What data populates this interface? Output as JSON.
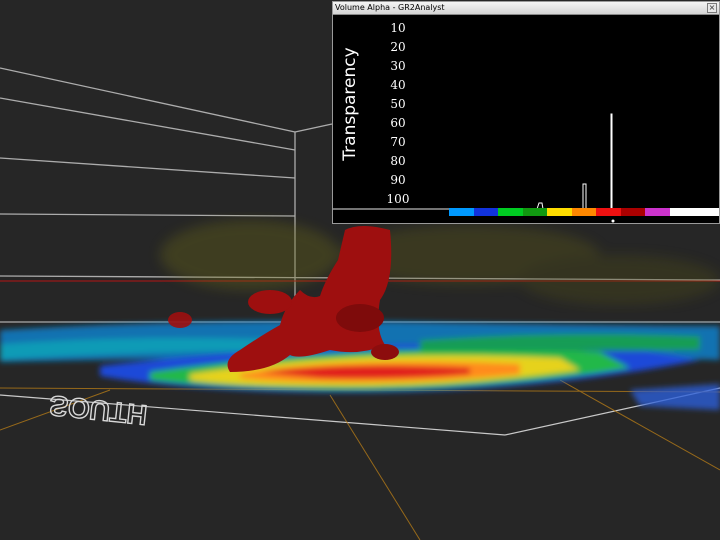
{
  "window": {
    "title": "Volume Alpha - GR2Analyst",
    "close_label": "×"
  },
  "chart_data": {
    "type": "line",
    "ylabel": "Transparency",
    "y_ticks": [
      "10",
      "20",
      "30",
      "40",
      "50",
      "60",
      "70",
      "80",
      "90",
      "100"
    ],
    "colorbar": [
      "#0099ff",
      "#1133dd",
      "#00cc22",
      "#119911",
      "#ffdd00",
      "#ff8800",
      "#ee1111",
      "#aa0000",
      "#cc33cc",
      "#ffffff",
      "#ffffff"
    ]
  },
  "scene": {
    "labels": [
      "SOUTH"
    ],
    "colors": {
      "background": "#262626",
      "storm_core": "#9e0f0f",
      "grid": "#bdbdbd"
    }
  }
}
